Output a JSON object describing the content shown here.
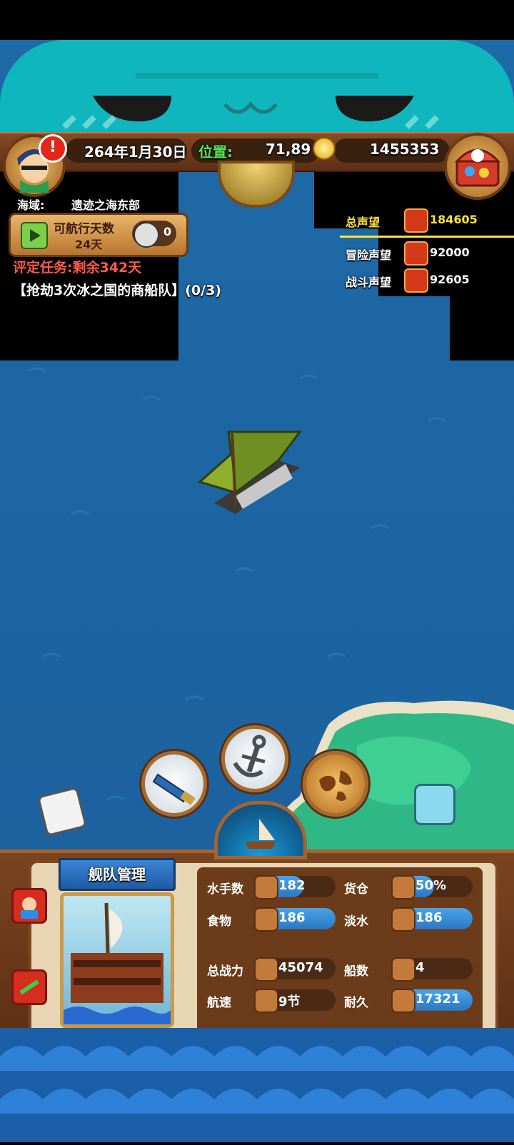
{
  "status": {
    "date": "264年1月30日",
    "location_label": "位置:",
    "location_value": "71,89",
    "gold": "1455353"
  },
  "sea_area": {
    "label": "海域:",
    "name": "遗迹之海东部"
  },
  "voyage": {
    "label": "可航行天数",
    "days": "24天",
    "counter": "0"
  },
  "mission": {
    "title": "评定任务:剩余342天",
    "detail": "【抢劫3次冰之国的商船队】(0/3)"
  },
  "reputation": {
    "total_label": "总声望",
    "total_value": "184605",
    "adventure_label": "冒险声望",
    "adventure_value": "92000",
    "battle_label": "战斗声望",
    "battle_value": "92605"
  },
  "fleet": {
    "title": "舰队管理",
    "stats": [
      {
        "label": "水手数",
        "value": "182",
        "fill": 0.58
      },
      {
        "label": "货仓",
        "value": "50%",
        "fill": 0.5
      },
      {
        "label": "食物",
        "value": "186",
        "fill": 1.0
      },
      {
        "label": "淡水",
        "value": "186",
        "fill": 1.0
      },
      {
        "label": "总战力",
        "value": "45074",
        "fill": 0.0
      },
      {
        "label": "船数",
        "value": "4",
        "fill": 0.0
      },
      {
        "label": "航速",
        "value": "9节",
        "fill": 0.0
      },
      {
        "label": "耐久",
        "value": "17321",
        "fill": 1.0
      }
    ]
  },
  "colors": {
    "sea": "#1e6aa8",
    "header_teal": "#0fb6bd",
    "wood": "#7b4420",
    "mission_red": "#ff5a4a",
    "reputation_yellow": "#ffe23a",
    "location_green": "#58e05a"
  },
  "icons": [
    "alert-icon",
    "gold-coin-icon",
    "treasure-chest-icon",
    "play-icon",
    "compass-icon",
    "spyglass-icon",
    "anchor-icon",
    "world-map-icon",
    "ship-icon"
  ]
}
